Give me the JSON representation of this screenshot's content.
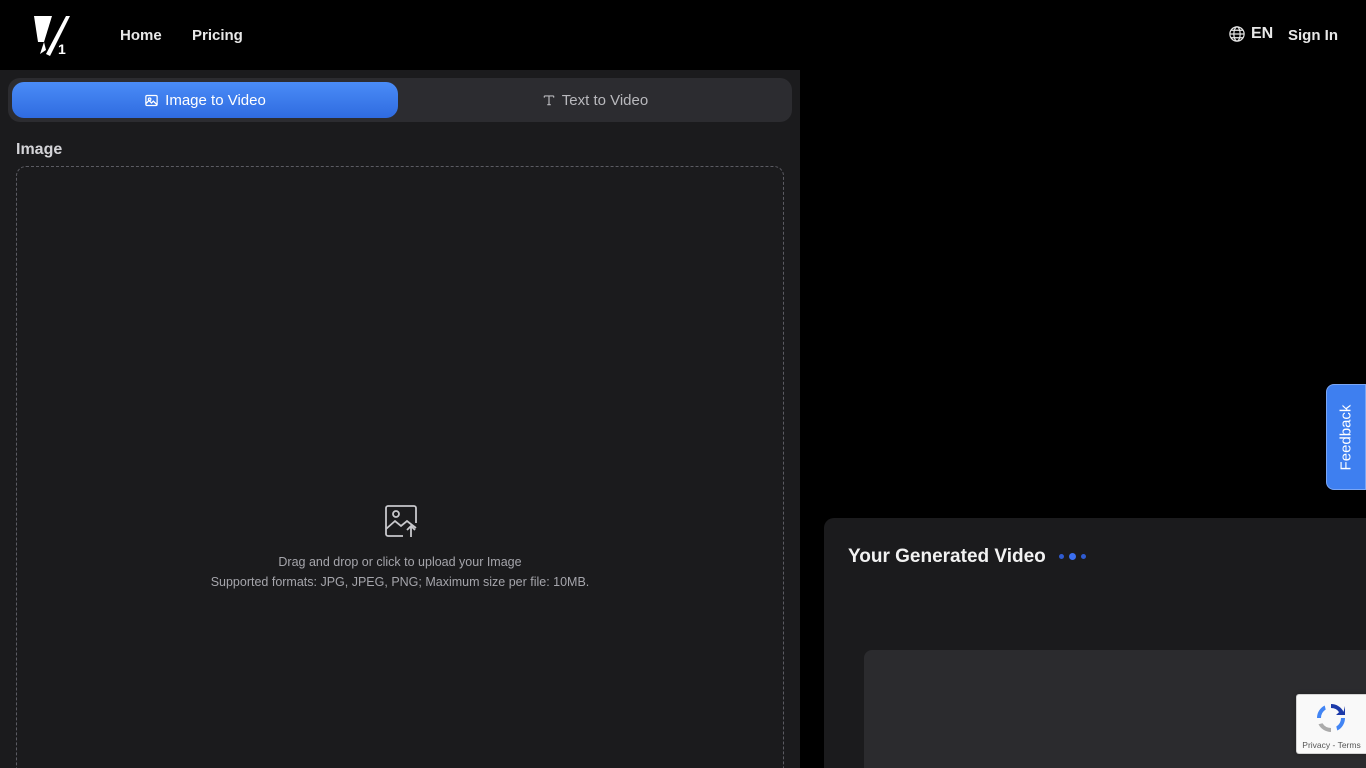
{
  "header": {
    "logo_alt": "V1",
    "nav": [
      {
        "label": "Home"
      },
      {
        "label": "Pricing"
      }
    ],
    "language": "EN",
    "signin_label": "Sign In"
  },
  "tabs": [
    {
      "label": "Image to Video",
      "icon": "image-icon",
      "active": true
    },
    {
      "label": "Text to Video",
      "icon": "text-icon",
      "active": false
    }
  ],
  "upload": {
    "section_label": "Image",
    "instruction": "Drag and drop or click to upload your Image",
    "formats": "Supported formats: JPG, JPEG, PNG; Maximum size per file: 10MB."
  },
  "result": {
    "title": "Your Generated Video"
  },
  "feedback_label": "Feedback",
  "recaptcha": {
    "links": "Privacy - Terms"
  },
  "colors": {
    "accent": "#3b7ef2",
    "panel": "#1b1b1d",
    "background": "#000000"
  }
}
